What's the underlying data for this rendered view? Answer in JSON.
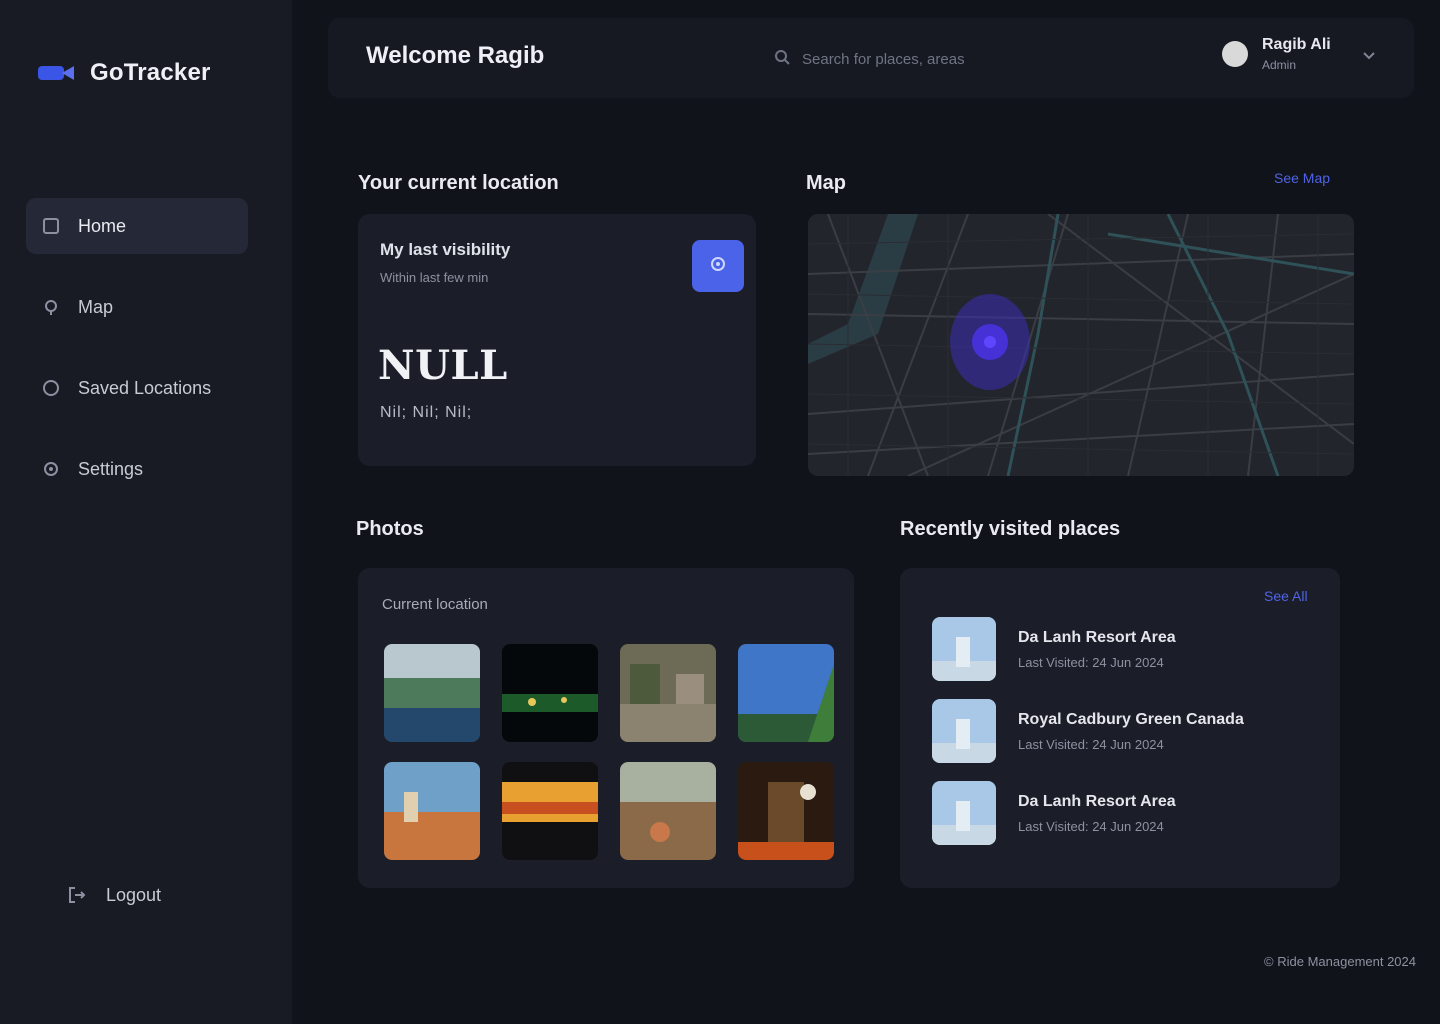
{
  "brand": {
    "name": "GoTracker"
  },
  "nav": {
    "items": [
      {
        "label": "Home",
        "icon": "home-icon"
      },
      {
        "label": "Map",
        "icon": "map-icon"
      },
      {
        "label": "Saved Locations",
        "icon": "bookmark-icon"
      },
      {
        "label": "Settings",
        "icon": "gear-icon"
      }
    ],
    "logout": "Logout"
  },
  "header": {
    "welcome": "Welcome Ragib",
    "search_placeholder": "Search for places, areas",
    "user_name": "Ragib Ali",
    "user_role": "Admin"
  },
  "current_location": {
    "section_title": "Your current location",
    "card_title": "My last visibility",
    "card_subtitle": "Within last few min",
    "value": "NULL",
    "coords": "Nil; Nil; Nil;"
  },
  "map": {
    "title": "Map",
    "link": "See Map"
  },
  "photos": {
    "title": "Photos",
    "subtitle": "Current location"
  },
  "recent": {
    "title": "Recently visited places",
    "link": "See All",
    "items": [
      {
        "name": "Da Lanh Resort Area",
        "date": "Last Visited: 24 Jun 2024"
      },
      {
        "name": "Royal Cadbury Green Canada",
        "date": "Last Visited: 24 Jun 2024"
      },
      {
        "name": "Da Lanh Resort Area",
        "date": "Last Visited: 24 Jun 2024"
      }
    ]
  },
  "footer": "© Ride Management 2024",
  "colors": {
    "accent": "#4a63e8",
    "bg": "#10131a",
    "sidebar": "#181b24",
    "card": "#1b1e29"
  }
}
